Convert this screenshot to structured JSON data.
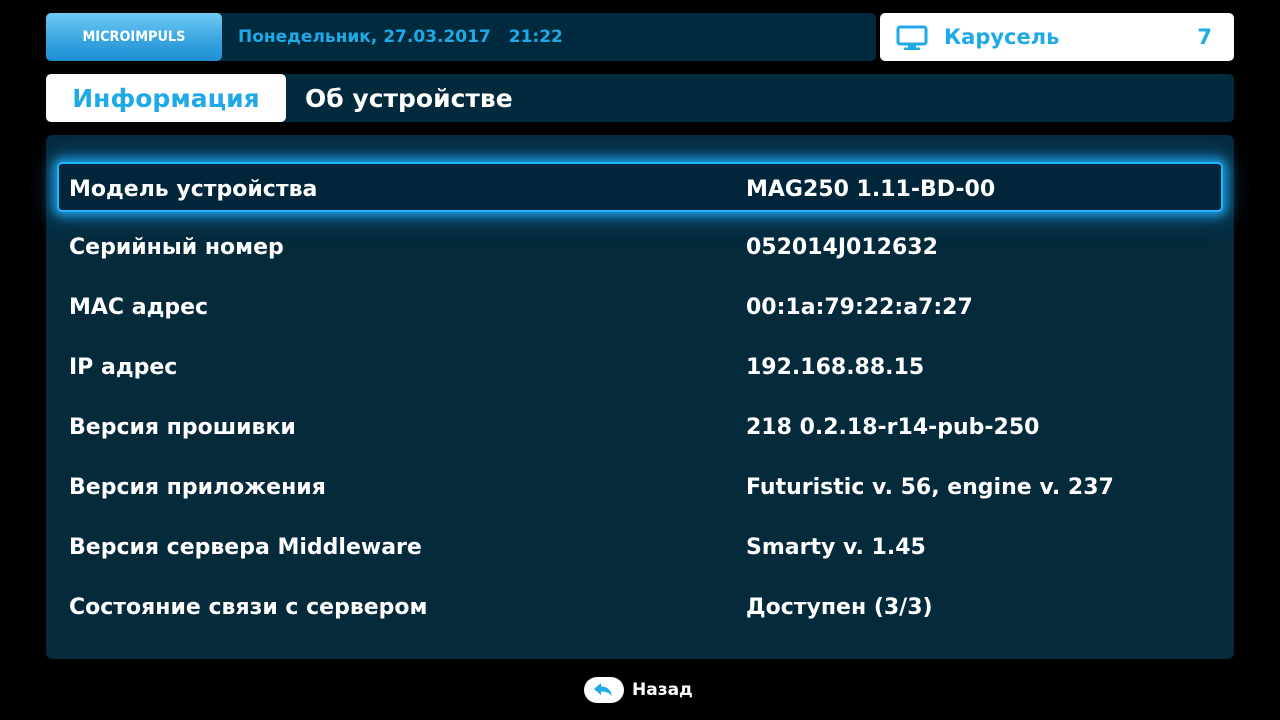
{
  "header": {
    "logo_text": "MICROIMPULS",
    "date": "Понедельник, 27.03.2017",
    "time": "21:22",
    "channel": {
      "icon": "tv-icon",
      "name": "Карусель",
      "number": "7"
    }
  },
  "tabs": {
    "active": "Информация",
    "current": "Об устройстве"
  },
  "info_rows": [
    {
      "label": "Модель устройства",
      "value": "MAG250 1.11-BD-00",
      "focused": true
    },
    {
      "label": "Серийный номер",
      "value": "052014J012632"
    },
    {
      "label": "MAC адрес",
      "value": "00:1a:79:22:a7:27"
    },
    {
      "label": "IP адрес",
      "value": "192.168.88.15"
    },
    {
      "label": "Версия прошивки",
      "value": "218 0.2.18-r14-pub-250"
    },
    {
      "label": "Версия приложения",
      "value": "Futuristic v. 56, engine v. 237"
    },
    {
      "label": "Версия сервера Middleware",
      "value": "Smarty v. 1.45"
    },
    {
      "label": "Состояние связи с сервером",
      "value": "Доступен (3/3)"
    }
  ],
  "footer": {
    "back_icon": "back-arrow-icon",
    "back_label": "Назад"
  },
  "colors": {
    "accent": "#1fa9e6",
    "panel": "#042a3c",
    "focus_glow": "#1fb4ff"
  }
}
